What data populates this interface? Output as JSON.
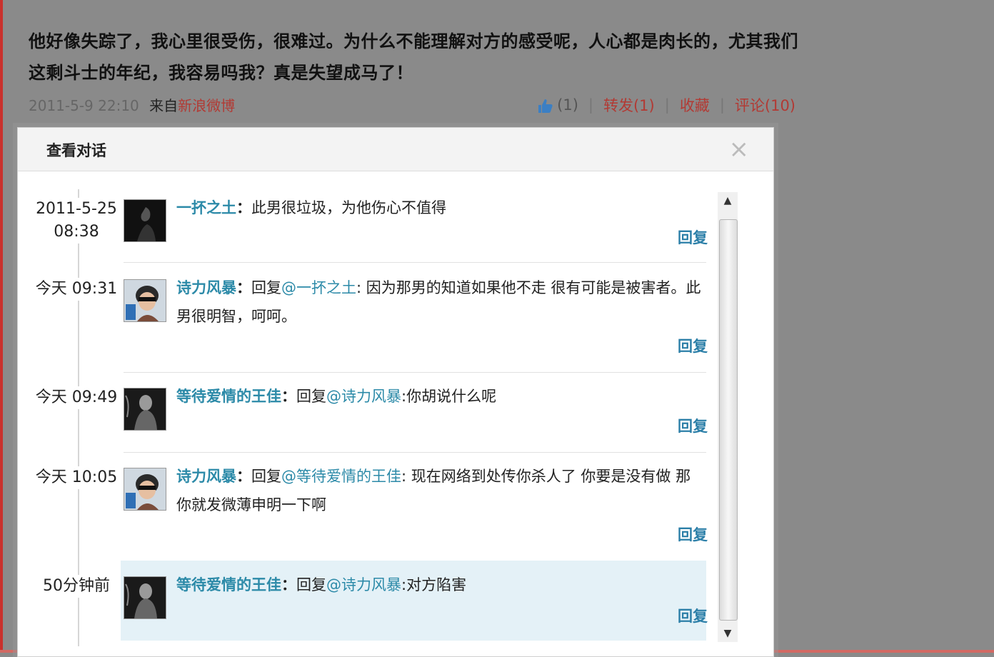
{
  "post": {
    "text": "他好像失踪了，我心里很受伤，很难过。为什么不能理解对方的感受呢，人心都是肉长的，尤其我们这剩斗士的年纪，我容易吗我？真是失望成马了！",
    "time": "2011-5-9 22:10",
    "source_prefix": "来自",
    "source_link": "新浪微博",
    "like_count": "(1)",
    "repost": "转发(1)",
    "favorite": "收藏",
    "comment": "评论(10)",
    "sep": "|"
  },
  "dialog": {
    "title": "查看对话",
    "close": "×",
    "reply_label": "回复",
    "messages": [
      {
        "time": "2011-5-25 08:38",
        "user": "一抔之土",
        "colon": "：",
        "prefix": "",
        "mention": "",
        "text": "此男很垃圾，为他伤心不值得"
      },
      {
        "time": "今天 09:31",
        "user": "诗力风暴",
        "colon": "：",
        "prefix": "回复",
        "mention": "@一抔之土",
        "text": ": 因为那男的知道如果他不走 很有可能是被害者。此男很明智，呵呵。"
      },
      {
        "time": "今天 09:49",
        "user": "等待爱情的王佳",
        "colon": "：",
        "prefix": "回复",
        "mention": "@诗力风暴",
        "text": ":你胡说什么呢"
      },
      {
        "time": "今天 10:05",
        "user": "诗力风暴",
        "colon": "：",
        "prefix": "回复",
        "mention": "@等待爱情的王佳",
        "text": ": 现在网络到处传你杀人了 你要是没有做 那你就发微薄申明一下啊"
      },
      {
        "time": "50分钟前",
        "user": "等待爱情的王佳",
        "colon": "：",
        "prefix": "回复",
        "mention": "@诗力风暴",
        "text": ":对方陷害"
      }
    ]
  },
  "colors": {
    "link_blue": "#2c8aa8",
    "link_red": "#b23a34",
    "highlight": "#e4f1f7"
  }
}
